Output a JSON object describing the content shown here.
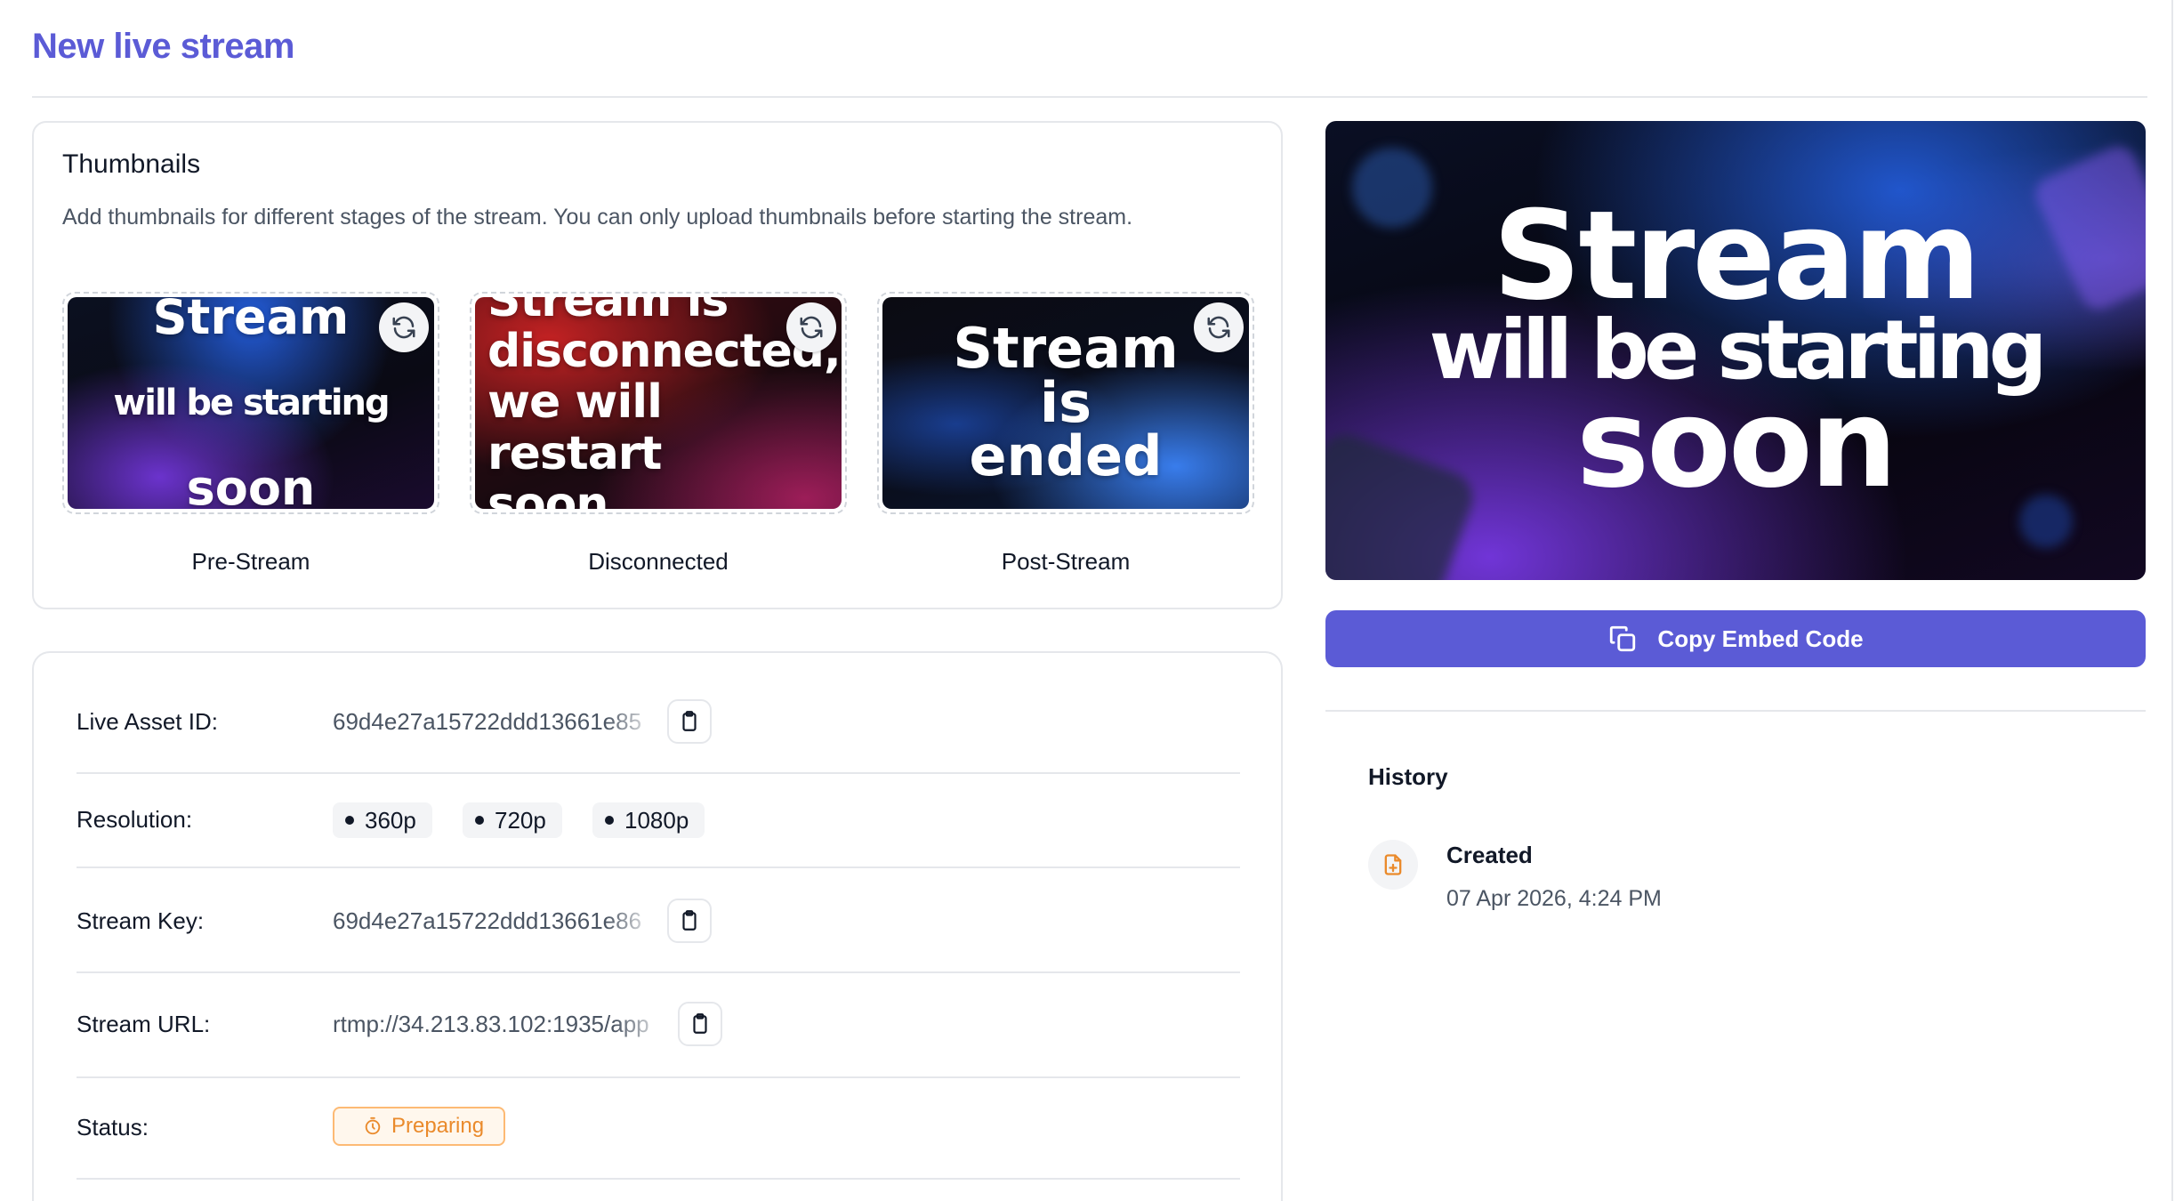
{
  "page": {
    "title": "New live stream"
  },
  "thumbnails": {
    "heading": "Thumbnails",
    "description": "Add thumbnails for different stages of the stream. You can only upload thumbnails before starting the stream.",
    "items": [
      {
        "label": "Pre-Stream",
        "image_text_big": "Stream",
        "image_text_small": "will be starting",
        "image_text_end": "soon"
      },
      {
        "label": "Disconnected",
        "image_text": "Stream is\ndisconnected,\nwe will restart\nsoon."
      },
      {
        "label": "Post-Stream",
        "image_text": "Stream\nis\nended"
      }
    ]
  },
  "details": {
    "live_asset_id": {
      "label": "Live Asset ID:",
      "value": "69d4e27a15722ddd13661e85"
    },
    "resolution": {
      "label": "Resolution:",
      "options": [
        "360p",
        "720p",
        "1080p"
      ]
    },
    "stream_key": {
      "label": "Stream Key:",
      "value": "69d4e27a15722ddd13661e86"
    },
    "stream_url": {
      "label": "Stream URL:",
      "value": "rtmp://34.213.83.102:1935/app"
    },
    "status": {
      "label": "Status:",
      "value": "Preparing",
      "color": "#ea8a2b"
    }
  },
  "preview": {
    "line1": "Stream",
    "line2": "will be starting",
    "line3": "soon"
  },
  "embed": {
    "button_label": "Copy Embed Code",
    "accent": "#5b5bd6"
  },
  "history": {
    "title": "History",
    "events": [
      {
        "event": "Created",
        "time": "07 Apr 2026, 4:24 PM",
        "icon": "file-plus-icon"
      }
    ]
  }
}
